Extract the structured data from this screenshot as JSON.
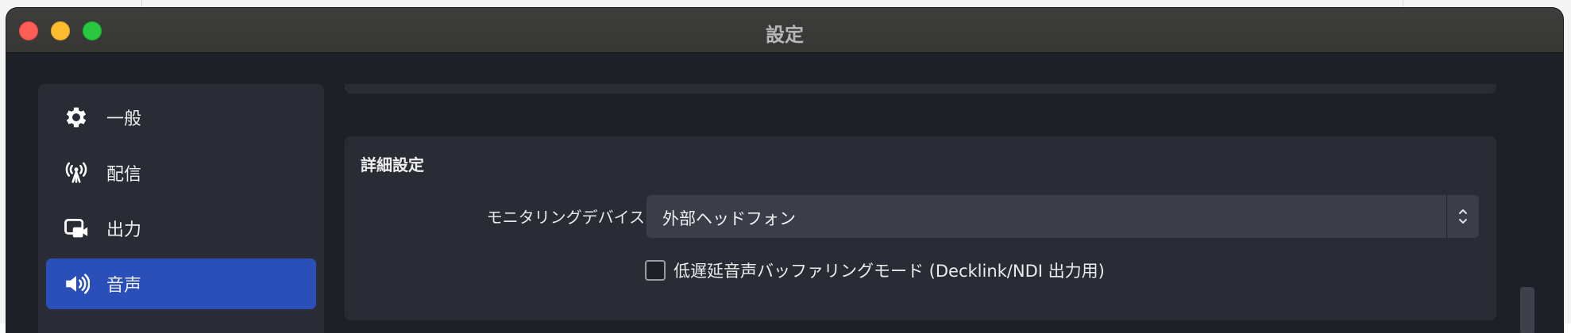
{
  "window": {
    "title": "設定"
  },
  "sidebar": {
    "items": [
      {
        "label": "一般",
        "icon": "gear-icon",
        "active": false
      },
      {
        "label": "配信",
        "icon": "broadcast-antenna-icon",
        "active": false
      },
      {
        "label": "出力",
        "icon": "output-camera-icon",
        "active": false
      },
      {
        "label": "音声",
        "icon": "speaker-icon",
        "active": true
      }
    ]
  },
  "advanced": {
    "title": "詳細設定",
    "monitoring_label": "モニタリングデバイス",
    "monitoring_value": "外部ヘッドフォン",
    "low_latency_label": "低遅延音声バッファリングモード (Decklink/NDI 出力用)",
    "low_latency_checked": false
  },
  "colors": {
    "accent": "#2a4fb8",
    "background": "#1e2028",
    "panel": "#2a2c35"
  }
}
